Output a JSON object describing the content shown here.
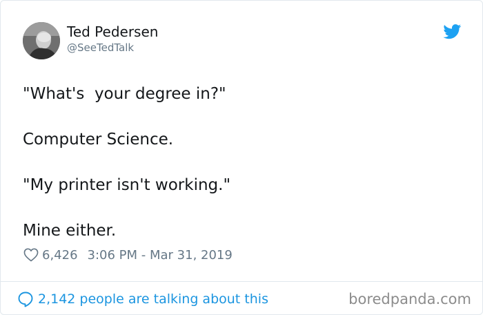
{
  "author": {
    "name": "Ted Pedersen",
    "handle": "@SeeTedTalk",
    "avatar_icon": "avatar-photo"
  },
  "platform_icon": "twitter-bird-icon",
  "tweet": {
    "paragraphs": [
      "\"What's  your degree in?\"",
      "Computer Science.",
      "\"My printer isn't working.\"",
      "Mine either."
    ]
  },
  "meta": {
    "like_icon": "heart-icon",
    "like_count": "6,426",
    "timestamp": "3:06 PM - Mar 31, 2019"
  },
  "footer": {
    "talk_icon": "speech-bubble-icon",
    "talk_text": "2,142 people are talking about this",
    "watermark": "boredpanda.com"
  },
  "colors": {
    "accent": "#1da1f2",
    "link": "#1b95e0",
    "secondary_text": "#657786",
    "primary_text": "#14171a",
    "border": "#e1e8ed"
  }
}
